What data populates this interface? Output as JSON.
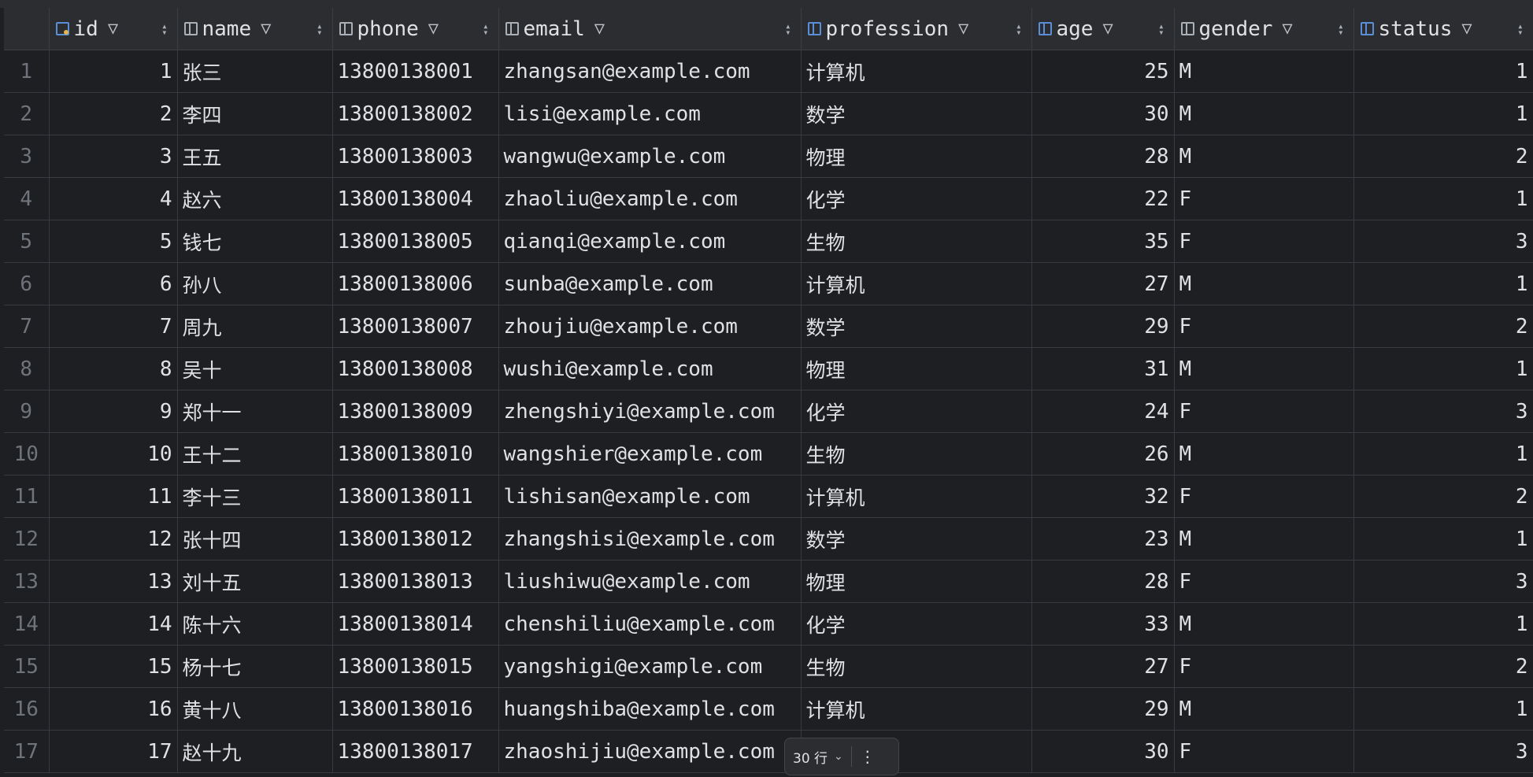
{
  "columns": [
    {
      "label": "id",
      "icon": "primary-key-column-icon"
    },
    {
      "label": "name",
      "icon": "column-icon"
    },
    {
      "label": "phone",
      "icon": "column-icon"
    },
    {
      "label": "email",
      "icon": "column-icon"
    },
    {
      "label": "profession",
      "icon": "indexed-column-icon"
    },
    {
      "label": "age",
      "icon": "indexed-column-icon"
    },
    {
      "label": "gender",
      "icon": "column-icon"
    },
    {
      "label": "status",
      "icon": "indexed-column-icon"
    }
  ],
  "rows": [
    {
      "n": "1",
      "id": "1",
      "name": "张三",
      "phone": "13800138001",
      "email": "zhangsan@example.com",
      "profession": "计算机",
      "age": "25",
      "gender": "M",
      "status": "1"
    },
    {
      "n": "2",
      "id": "2",
      "name": "李四",
      "phone": "13800138002",
      "email": "lisi@example.com",
      "profession": "数学",
      "age": "30",
      "gender": "M",
      "status": "1"
    },
    {
      "n": "3",
      "id": "3",
      "name": "王五",
      "phone": "13800138003",
      "email": "wangwu@example.com",
      "profession": "物理",
      "age": "28",
      "gender": "M",
      "status": "2"
    },
    {
      "n": "4",
      "id": "4",
      "name": "赵六",
      "phone": "13800138004",
      "email": "zhaoliu@example.com",
      "profession": "化学",
      "age": "22",
      "gender": "F",
      "status": "1"
    },
    {
      "n": "5",
      "id": "5",
      "name": "钱七",
      "phone": "13800138005",
      "email": "qianqi@example.com",
      "profession": "生物",
      "age": "35",
      "gender": "F",
      "status": "3"
    },
    {
      "n": "6",
      "id": "6",
      "name": "孙八",
      "phone": "13800138006",
      "email": "sunba@example.com",
      "profession": "计算机",
      "age": "27",
      "gender": "M",
      "status": "1"
    },
    {
      "n": "7",
      "id": "7",
      "name": "周九",
      "phone": "13800138007",
      "email": "zhoujiu@example.com",
      "profession": "数学",
      "age": "29",
      "gender": "F",
      "status": "2"
    },
    {
      "n": "8",
      "id": "8",
      "name": "吴十",
      "phone": "13800138008",
      "email": "wushi@example.com",
      "profession": "物理",
      "age": "31",
      "gender": "M",
      "status": "1"
    },
    {
      "n": "9",
      "id": "9",
      "name": "郑十一",
      "phone": "13800138009",
      "email": "zhengshiyi@example.com",
      "profession": "化学",
      "age": "24",
      "gender": "F",
      "status": "3"
    },
    {
      "n": "10",
      "id": "10",
      "name": "王十二",
      "phone": "13800138010",
      "email": "wangshier@example.com",
      "profession": "生物",
      "age": "26",
      "gender": "M",
      "status": "1"
    },
    {
      "n": "11",
      "id": "11",
      "name": "李十三",
      "phone": "13800138011",
      "email": "lishisan@example.com",
      "profession": "计算机",
      "age": "32",
      "gender": "F",
      "status": "2"
    },
    {
      "n": "12",
      "id": "12",
      "name": "张十四",
      "phone": "13800138012",
      "email": "zhangshisi@example.com",
      "profession": "数学",
      "age": "23",
      "gender": "M",
      "status": "1"
    },
    {
      "n": "13",
      "id": "13",
      "name": "刘十五",
      "phone": "13800138013",
      "email": "liushiwu@example.com",
      "profession": "物理",
      "age": "28",
      "gender": "F",
      "status": "3"
    },
    {
      "n": "14",
      "id": "14",
      "name": "陈十六",
      "phone": "13800138014",
      "email": "chenshiliu@example.com",
      "profession": "化学",
      "age": "33",
      "gender": "M",
      "status": "1"
    },
    {
      "n": "15",
      "id": "15",
      "name": "杨十七",
      "phone": "13800138015",
      "email": "yangshigi@example.com",
      "profession": "生物",
      "age": "27",
      "gender": "F",
      "status": "2"
    },
    {
      "n": "16",
      "id": "16",
      "name": "黄十八",
      "phone": "13800138016",
      "email": "huangshiba@example.com",
      "profession": "计算机",
      "age": "29",
      "gender": "M",
      "status": "1"
    },
    {
      "n": "17",
      "id": "17",
      "name": "赵十九",
      "phone": "13800138017",
      "email": "zhaoshijiu@example.com",
      "profession": "",
      "age": "30",
      "gender": "F",
      "status": "3"
    }
  ],
  "pager": {
    "rows_label": "30 行"
  }
}
